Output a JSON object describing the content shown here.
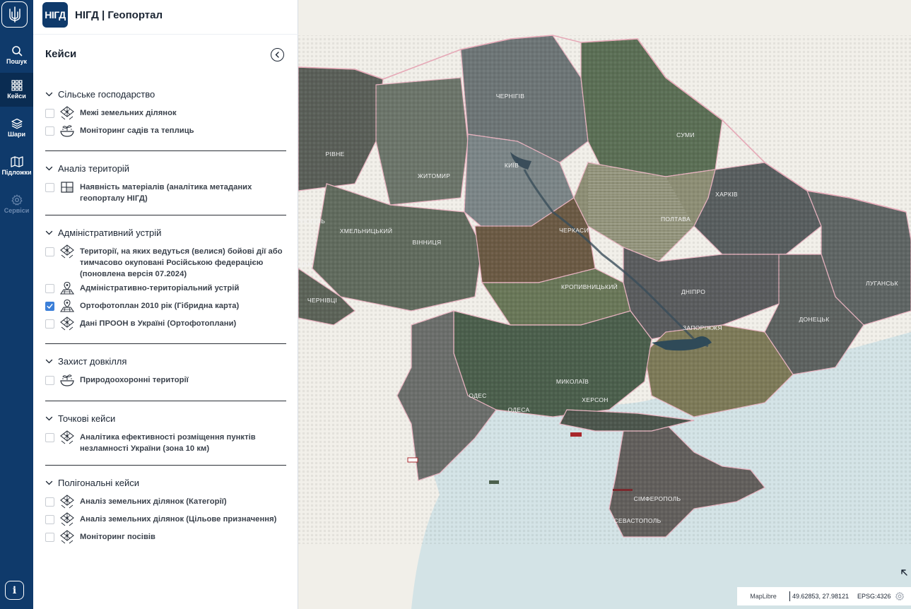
{
  "rail": {
    "items": [
      {
        "label": "Пошук"
      },
      {
        "label": "Кейси"
      },
      {
        "label": "Шари"
      },
      {
        "label": "Підложки"
      },
      {
        "label": "Сервіси"
      }
    ]
  },
  "brand": {
    "logo": "НІГД",
    "title": "НІГД | Геопортал"
  },
  "panel": {
    "title": "Кейси"
  },
  "sections": [
    {
      "title": "Сільське господарство",
      "items": [
        {
          "label": "Межі земельних ділянок",
          "checked": false,
          "icon": "land-plot-icon"
        },
        {
          "label": "Моніторинг садів та теплиць",
          "checked": false,
          "icon": "plant-bowl-icon"
        }
      ]
    },
    {
      "title": "Аналіз територій",
      "items": [
        {
          "label": "Наявність матеріалів (аналітика метаданих геопорталу НІГД)",
          "checked": false,
          "icon": "grid-map-icon"
        }
      ]
    },
    {
      "title": "Адміністративний устрій",
      "items": [
        {
          "label": "Території, на яких ведуться (велися) бойові дії або тимчасово окуповані Російською федерацією (поновлена версія 07.2024)",
          "checked": false,
          "icon": "land-plot-icon"
        },
        {
          "label": "Адміністративно-територіальний устрій",
          "checked": false,
          "icon": "map-pin-icon"
        },
        {
          "label": "Ортофотоплан 2010 рік (Гібридна карта)",
          "checked": true,
          "icon": "map-pin-icon"
        },
        {
          "label": "Дані ПРООН в Україні (Ортофотоплани)",
          "checked": false,
          "icon": "land-plot-icon"
        }
      ]
    },
    {
      "title": "Захист довкілля",
      "items": [
        {
          "label": "Природоохоронні території",
          "checked": false,
          "icon": "plant-bowl-icon"
        }
      ]
    },
    {
      "title": "Точкові кейси",
      "items": [
        {
          "label": "Аналітика ефективності розміщення пунктів незламності України (зона 10 км)",
          "checked": false,
          "icon": "land-plot-icon"
        }
      ]
    },
    {
      "title": "Полігональні кейси",
      "items": [
        {
          "label": "Аналіз земельних ділянок (Категорії)",
          "checked": false,
          "icon": "land-plot-icon"
        },
        {
          "label": "Аналіз земельних ділянок (Цільове призначення)",
          "checked": false,
          "icon": "land-plot-icon"
        },
        {
          "label": "Моніторинг посівів",
          "checked": false,
          "icon": "land-plot-icon"
        }
      ]
    }
  ],
  "map": {
    "labels": [
      "ЧЕРНІГІВ",
      "СУМИ",
      "РІВНЕ",
      "ЖИТОМИР",
      "КИЇВ",
      "ХАРКІВ",
      "ПОЛТАВА",
      "ЧЕРКАСИ",
      "ХМЕЛЬНИЦЬКИЙ",
      "ВІННИЦЯ",
      "КРОПИВНИЦЬКИЙ",
      "ДНІПРО",
      "ЛУГАНСЬК",
      "ДОНЕЦЬК",
      "ЗАПОРІЖЖЯ",
      "МИКОЛАЇВ",
      "ХЕРСОН",
      "ОДЕСА",
      "ОДЕС",
      "СІМФЕРОПОЛЬ",
      "СЕВАСТОПОЛЬ",
      "ЧЕРНІВЦІ",
      "РНОПІЛЬ",
      "ЦЬК"
    ],
    "attribution": "MapLibre",
    "coordinates": "49.62853, 27.98121",
    "epsg": "EPSG:4326"
  },
  "colors": {
    "rail": "#0f3a6b",
    "accent": "#3b7fd8"
  }
}
